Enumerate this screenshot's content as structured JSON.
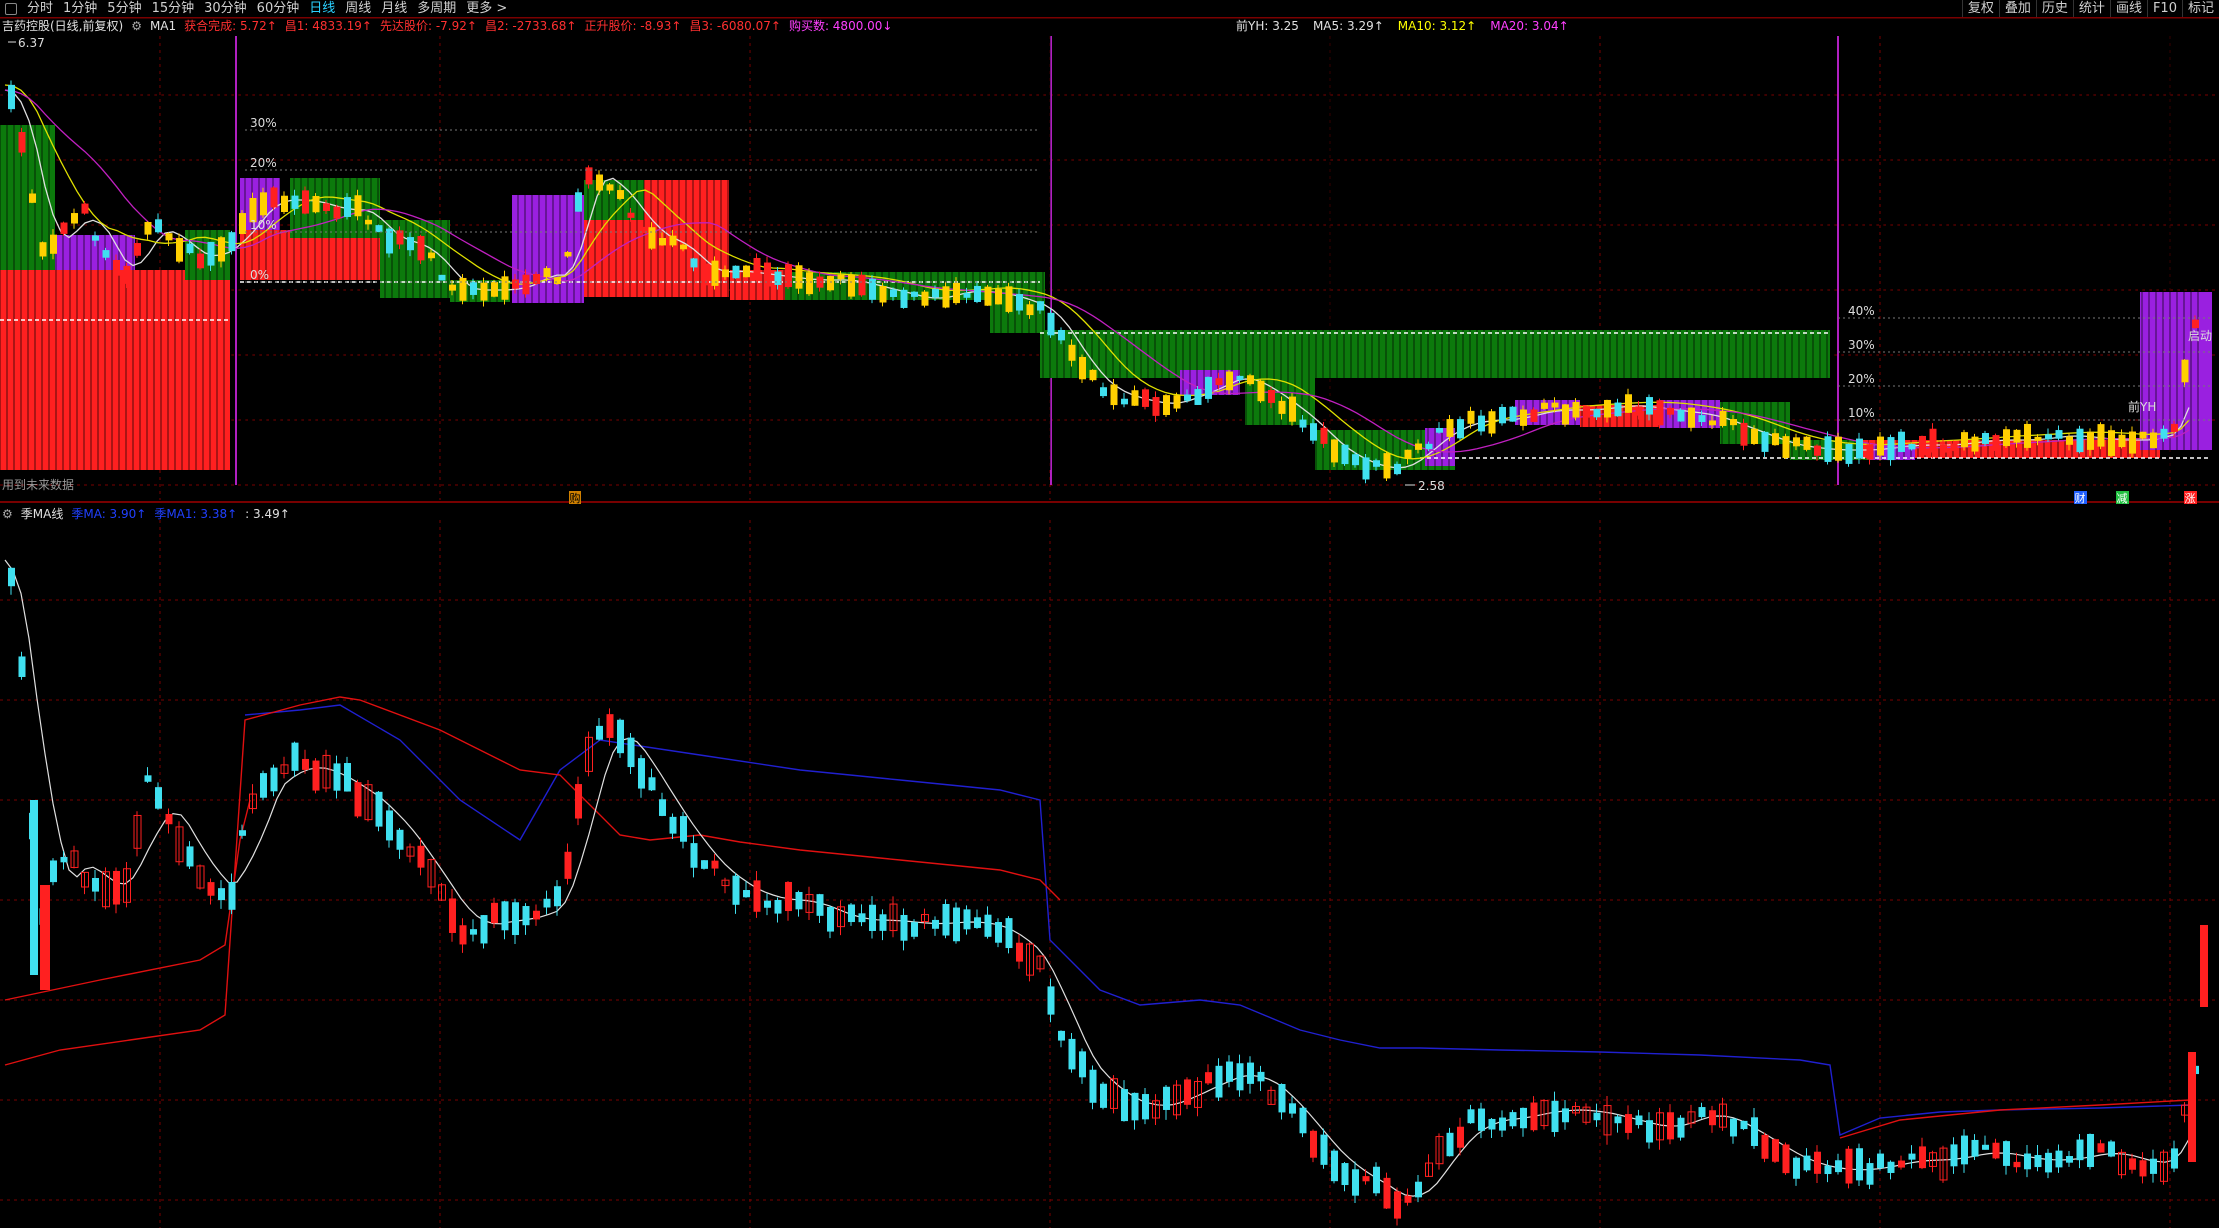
{
  "toolbar": {
    "periods": [
      "分时",
      "1分钟",
      "5分钟",
      "15分钟",
      "30分钟",
      "60分钟",
      "日线",
      "周线",
      "月线",
      "多周期",
      "更多 >"
    ],
    "active_index": 6,
    "right_buttons": [
      "复权",
      "叠加",
      "历史",
      "统计",
      "画线",
      "F10",
      "标记"
    ]
  },
  "main_panel": {
    "stock_title": "吉药控股(日线,前复权)",
    "indicator_name": "MA1",
    "labels": [
      {
        "text": "获合完成: 5.72↑",
        "color": "#ff3030"
      },
      {
        "text": "昌1: 4833.19↑",
        "color": "#ff3030"
      },
      {
        "text": "先达股价: -7.92↑",
        "color": "#ff3030"
      },
      {
        "text": "昌2: -2733.68↑",
        "color": "#ff3030"
      },
      {
        "text": "正升股价: -8.93↑",
        "color": "#ff3030"
      },
      {
        "text": "昌3: -6080.07↑",
        "color": "#ff3030"
      },
      {
        "text": "购买数: 4800.00↓",
        "color": "#ff40ff"
      }
    ],
    "ma_labels": [
      {
        "text": "前YH: 3.25",
        "color": "#e0e0e0"
      },
      {
        "text": "MA5: 3.29↑",
        "color": "#e0e0e0"
      },
      {
        "text": "MA10: 3.12↑",
        "color": "#ffff00"
      },
      {
        "text": "MA20: 3.04↑",
        "color": "#ff40ff"
      }
    ],
    "high_label": "6.37",
    "low_label": "2.58",
    "pct_ticks_middle": [
      "30%",
      "20%",
      "10%",
      "0%"
    ],
    "pct_ticks_right": [
      "40%",
      "30%",
      "20%",
      "10%"
    ],
    "note": "用到未来数据",
    "marker_buy": "购",
    "right_markers": [
      "财",
      "减",
      "涨"
    ],
    "qianyh_label": "前YH",
    "qidong_label": "启动"
  },
  "sub_panel": {
    "title": "季MA线",
    "labels": [
      {
        "text": "季MA: 3.90↑",
        "color": "#2040ff"
      },
      {
        "text": "季MA1: 3.38↑",
        "color": "#2040ff"
      },
      {
        "text": ": 3.49↑",
        "color": "#e0e0e0"
      }
    ]
  },
  "colors": {
    "up": "#ff2020",
    "down": "#40e0f0",
    "yellow": "#ffd000",
    "green_block": "#0c7a0c",
    "purple_block": "#9a20e0",
    "grid": "#7a0000",
    "ma5": "#e0e0e0",
    "ma10": "#e0e000",
    "ma20": "#c020c0",
    "ji_ma": "#2020d0",
    "ji_ma1": "#e01010"
  }
}
